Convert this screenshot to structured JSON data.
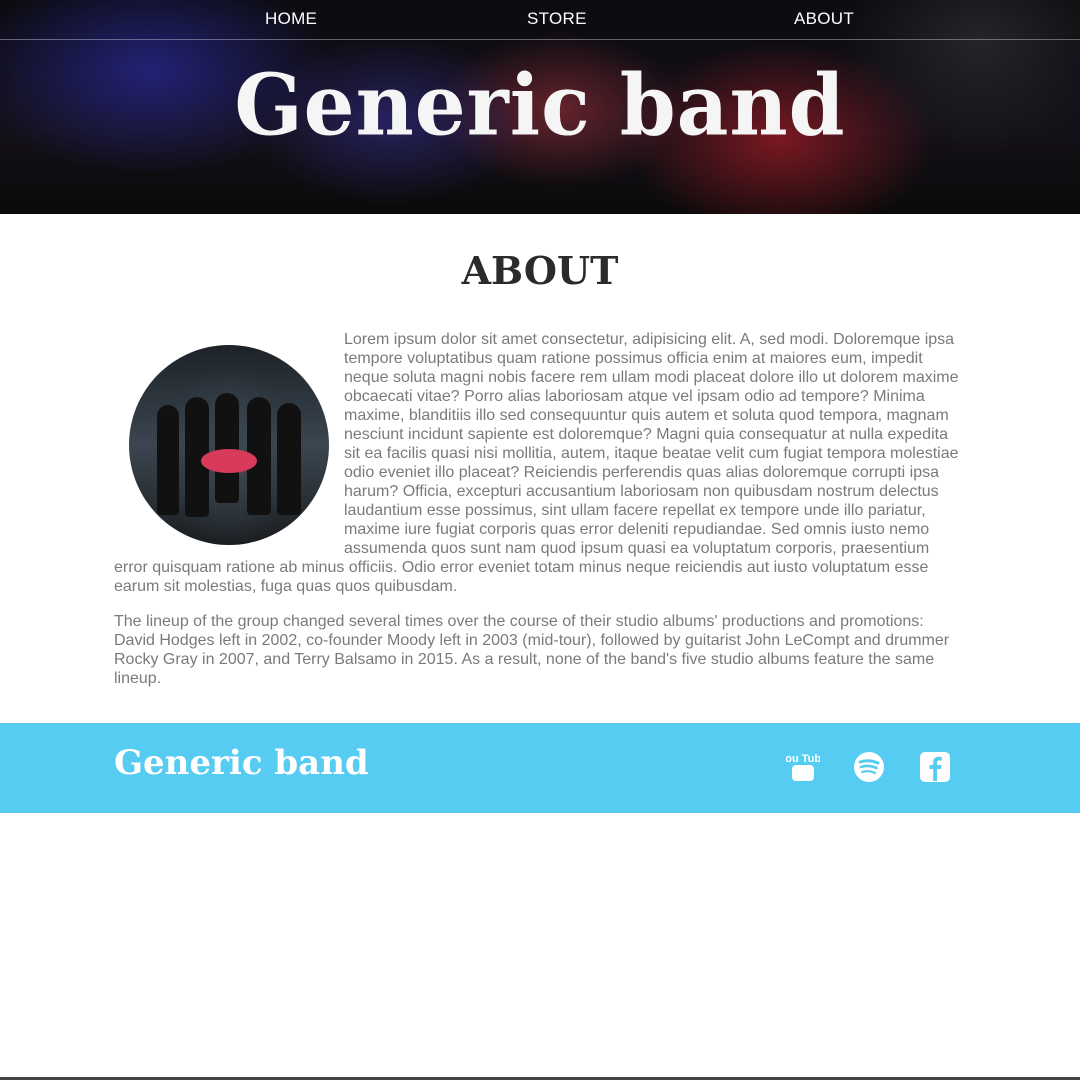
{
  "nav": {
    "home": "HOME",
    "store": "STORE",
    "about": "ABOUT"
  },
  "hero": {
    "title": "Generic band"
  },
  "about": {
    "heading": "ABOUT",
    "paragraph1": "Lorem ipsum dolor sit amet consectetur, adipisicing elit. A, sed modi. Doloremque ipsa tempore voluptatibus quam ratione possimus officia enim at maiores eum, impedit neque soluta magni nobis facere rem ullam modi placeat dolore illo ut dolorem maxime obcaecati vitae? Porro alias laboriosam atque vel ipsam odio ad tempore? Minima maxime, blanditiis illo sed consequuntur quis autem et soluta quod tempora, magnam nesciunt incidunt sapiente est doloremque? Magni quia consequatur at nulla expedita sit ea facilis quasi nisi mollitia, autem, itaque beatae velit cum fugiat tempora molestiae odio eveniet illo placeat? Reiciendis perferendis quas alias doloremque corrupti ipsa harum? Officia, excepturi accusantium laboriosam non quibusdam nostrum delectus laudantium esse possimus, sint ullam facere repellat ex tempore unde illo pariatur, maxime iure fugiat corporis quas error deleniti repudiandae. Sed omnis iusto nemo assumenda quos sunt nam quod ipsum quasi ea voluptatum corporis, praesentium error quisquam ratione ab minus officiis. Odio error eveniet totam minus neque reiciendis aut iusto voluptatum esse earum sit molestias, fuga quas quos quibusdam.",
    "paragraph2": "The lineup of the group changed several times over the course of their studio albums' productions and promotions: David Hodges left in 2002, co-founder Moody left in 2003 (mid-tour), followed by guitarist John LeCompt and drummer Rocky Gray in 2007, and Terry Balsamo in 2015. As a result, none of the band's five studio albums feature the same lineup.",
    "photo_icon": "band-photo"
  },
  "footer": {
    "title": "Generic band",
    "social": [
      {
        "icon": "youtube-icon",
        "text": "You Tube"
      },
      {
        "icon": "spotify-icon"
      },
      {
        "icon": "facebook-icon"
      }
    ],
    "accent": "#56ccf2"
  }
}
